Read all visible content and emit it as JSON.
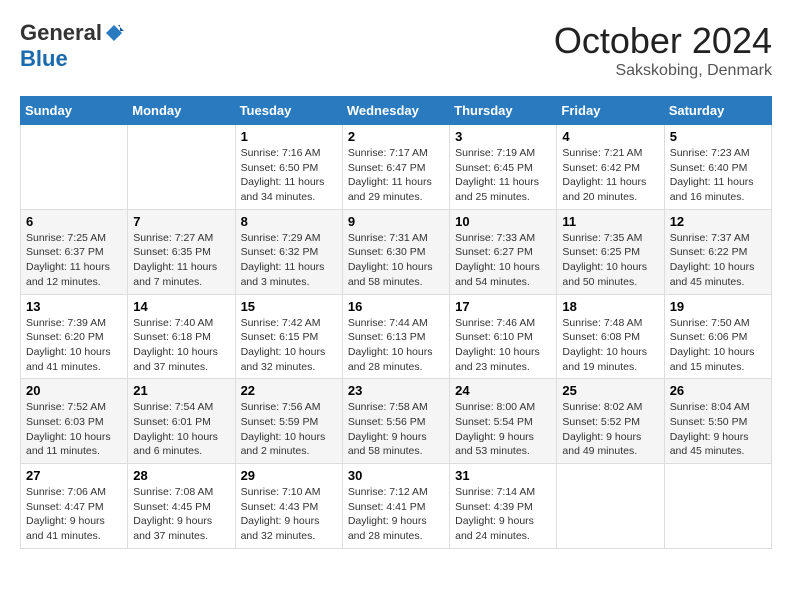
{
  "header": {
    "logo_general": "General",
    "logo_blue": "Blue",
    "month_title": "October 2024",
    "subtitle": "Sakskobing, Denmark"
  },
  "days_of_week": [
    "Sunday",
    "Monday",
    "Tuesday",
    "Wednesday",
    "Thursday",
    "Friday",
    "Saturday"
  ],
  "weeks": [
    [
      {
        "day": null,
        "sunrise": null,
        "sunset": null,
        "daylight": null
      },
      {
        "day": null,
        "sunrise": null,
        "sunset": null,
        "daylight": null
      },
      {
        "day": "1",
        "sunrise": "Sunrise: 7:16 AM",
        "sunset": "Sunset: 6:50 PM",
        "daylight": "Daylight: 11 hours and 34 minutes."
      },
      {
        "day": "2",
        "sunrise": "Sunrise: 7:17 AM",
        "sunset": "Sunset: 6:47 PM",
        "daylight": "Daylight: 11 hours and 29 minutes."
      },
      {
        "day": "3",
        "sunrise": "Sunrise: 7:19 AM",
        "sunset": "Sunset: 6:45 PM",
        "daylight": "Daylight: 11 hours and 25 minutes."
      },
      {
        "day": "4",
        "sunrise": "Sunrise: 7:21 AM",
        "sunset": "Sunset: 6:42 PM",
        "daylight": "Daylight: 11 hours and 20 minutes."
      },
      {
        "day": "5",
        "sunrise": "Sunrise: 7:23 AM",
        "sunset": "Sunset: 6:40 PM",
        "daylight": "Daylight: 11 hours and 16 minutes."
      }
    ],
    [
      {
        "day": "6",
        "sunrise": "Sunrise: 7:25 AM",
        "sunset": "Sunset: 6:37 PM",
        "daylight": "Daylight: 11 hours and 12 minutes."
      },
      {
        "day": "7",
        "sunrise": "Sunrise: 7:27 AM",
        "sunset": "Sunset: 6:35 PM",
        "daylight": "Daylight: 11 hours and 7 minutes."
      },
      {
        "day": "8",
        "sunrise": "Sunrise: 7:29 AM",
        "sunset": "Sunset: 6:32 PM",
        "daylight": "Daylight: 11 hours and 3 minutes."
      },
      {
        "day": "9",
        "sunrise": "Sunrise: 7:31 AM",
        "sunset": "Sunset: 6:30 PM",
        "daylight": "Daylight: 10 hours and 58 minutes."
      },
      {
        "day": "10",
        "sunrise": "Sunrise: 7:33 AM",
        "sunset": "Sunset: 6:27 PM",
        "daylight": "Daylight: 10 hours and 54 minutes."
      },
      {
        "day": "11",
        "sunrise": "Sunrise: 7:35 AM",
        "sunset": "Sunset: 6:25 PM",
        "daylight": "Daylight: 10 hours and 50 minutes."
      },
      {
        "day": "12",
        "sunrise": "Sunrise: 7:37 AM",
        "sunset": "Sunset: 6:22 PM",
        "daylight": "Daylight: 10 hours and 45 minutes."
      }
    ],
    [
      {
        "day": "13",
        "sunrise": "Sunrise: 7:39 AM",
        "sunset": "Sunset: 6:20 PM",
        "daylight": "Daylight: 10 hours and 41 minutes."
      },
      {
        "day": "14",
        "sunrise": "Sunrise: 7:40 AM",
        "sunset": "Sunset: 6:18 PM",
        "daylight": "Daylight: 10 hours and 37 minutes."
      },
      {
        "day": "15",
        "sunrise": "Sunrise: 7:42 AM",
        "sunset": "Sunset: 6:15 PM",
        "daylight": "Daylight: 10 hours and 32 minutes."
      },
      {
        "day": "16",
        "sunrise": "Sunrise: 7:44 AM",
        "sunset": "Sunset: 6:13 PM",
        "daylight": "Daylight: 10 hours and 28 minutes."
      },
      {
        "day": "17",
        "sunrise": "Sunrise: 7:46 AM",
        "sunset": "Sunset: 6:10 PM",
        "daylight": "Daylight: 10 hours and 23 minutes."
      },
      {
        "day": "18",
        "sunrise": "Sunrise: 7:48 AM",
        "sunset": "Sunset: 6:08 PM",
        "daylight": "Daylight: 10 hours and 19 minutes."
      },
      {
        "day": "19",
        "sunrise": "Sunrise: 7:50 AM",
        "sunset": "Sunset: 6:06 PM",
        "daylight": "Daylight: 10 hours and 15 minutes."
      }
    ],
    [
      {
        "day": "20",
        "sunrise": "Sunrise: 7:52 AM",
        "sunset": "Sunset: 6:03 PM",
        "daylight": "Daylight: 10 hours and 11 minutes."
      },
      {
        "day": "21",
        "sunrise": "Sunrise: 7:54 AM",
        "sunset": "Sunset: 6:01 PM",
        "daylight": "Daylight: 10 hours and 6 minutes."
      },
      {
        "day": "22",
        "sunrise": "Sunrise: 7:56 AM",
        "sunset": "Sunset: 5:59 PM",
        "daylight": "Daylight: 10 hours and 2 minutes."
      },
      {
        "day": "23",
        "sunrise": "Sunrise: 7:58 AM",
        "sunset": "Sunset: 5:56 PM",
        "daylight": "Daylight: 9 hours and 58 minutes."
      },
      {
        "day": "24",
        "sunrise": "Sunrise: 8:00 AM",
        "sunset": "Sunset: 5:54 PM",
        "daylight": "Daylight: 9 hours and 53 minutes."
      },
      {
        "day": "25",
        "sunrise": "Sunrise: 8:02 AM",
        "sunset": "Sunset: 5:52 PM",
        "daylight": "Daylight: 9 hours and 49 minutes."
      },
      {
        "day": "26",
        "sunrise": "Sunrise: 8:04 AM",
        "sunset": "Sunset: 5:50 PM",
        "daylight": "Daylight: 9 hours and 45 minutes."
      }
    ],
    [
      {
        "day": "27",
        "sunrise": "Sunrise: 7:06 AM",
        "sunset": "Sunset: 4:47 PM",
        "daylight": "Daylight: 9 hours and 41 minutes."
      },
      {
        "day": "28",
        "sunrise": "Sunrise: 7:08 AM",
        "sunset": "Sunset: 4:45 PM",
        "daylight": "Daylight: 9 hours and 37 minutes."
      },
      {
        "day": "29",
        "sunrise": "Sunrise: 7:10 AM",
        "sunset": "Sunset: 4:43 PM",
        "daylight": "Daylight: 9 hours and 32 minutes."
      },
      {
        "day": "30",
        "sunrise": "Sunrise: 7:12 AM",
        "sunset": "Sunset: 4:41 PM",
        "daylight": "Daylight: 9 hours and 28 minutes."
      },
      {
        "day": "31",
        "sunrise": "Sunrise: 7:14 AM",
        "sunset": "Sunset: 4:39 PM",
        "daylight": "Daylight: 9 hours and 24 minutes."
      },
      {
        "day": null,
        "sunrise": null,
        "sunset": null,
        "daylight": null
      },
      {
        "day": null,
        "sunrise": null,
        "sunset": null,
        "daylight": null
      }
    ]
  ]
}
